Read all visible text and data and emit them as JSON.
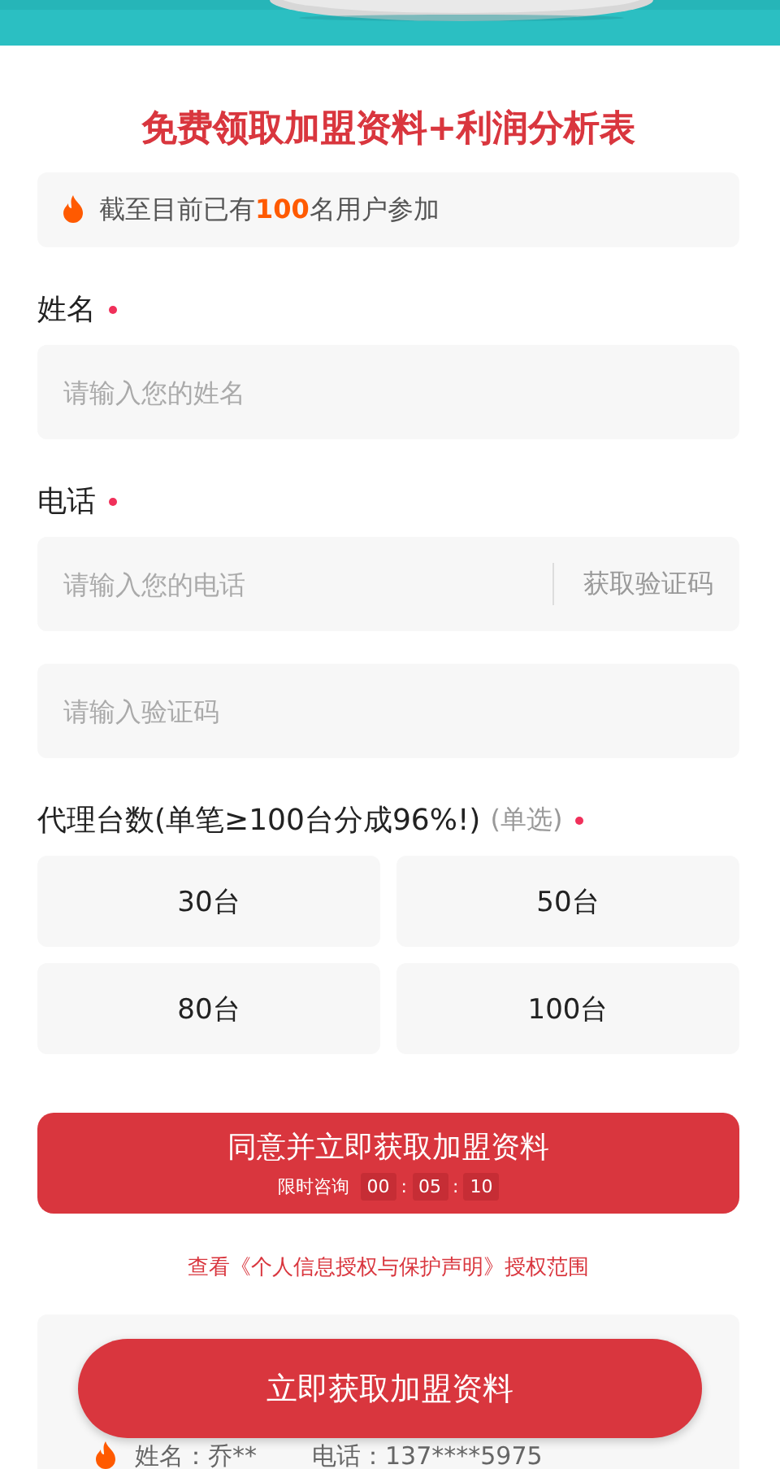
{
  "title": "免费领取加盟资料+利润分析表",
  "notice": "截至目前已有**100**名用户参加",
  "fields": [
    {
      "label": "姓名",
      "required": true,
      "placeholder": "请输入您的姓名"
    },
    {
      "label": "电话",
      "required": true,
      "placeholder": "请输入您的电话",
      "action": "获取验证码"
    },
    {
      "placeholder": "请输入验证码"
    }
  ],
  "quantity": {
    "label": "代理台数(单笔≥100台分成96%!)",
    "hint": "(单选)",
    "required": true,
    "options": [
      {
        "label": "30台",
        "selected": false
      },
      {
        "label": "50台",
        "selected": false
      },
      {
        "label": "80台",
        "selected": false
      },
      {
        "label": "100台",
        "selected": false
      }
    ]
  },
  "submit": {
    "label": "同意并立即获取加盟资料",
    "timer_label": "限时咨询",
    "timer": [
      "00",
      "05",
      "10"
    ],
    "timer_separator": ":"
  },
  "privacy_link": "查看《个人信息授权与保护声明》授权范围",
  "ticker": [
    {
      "name": "姓名：乔**",
      "phone": "电话：137****5975"
    }
  ],
  "floating_button": "立即获取加盟资料"
}
